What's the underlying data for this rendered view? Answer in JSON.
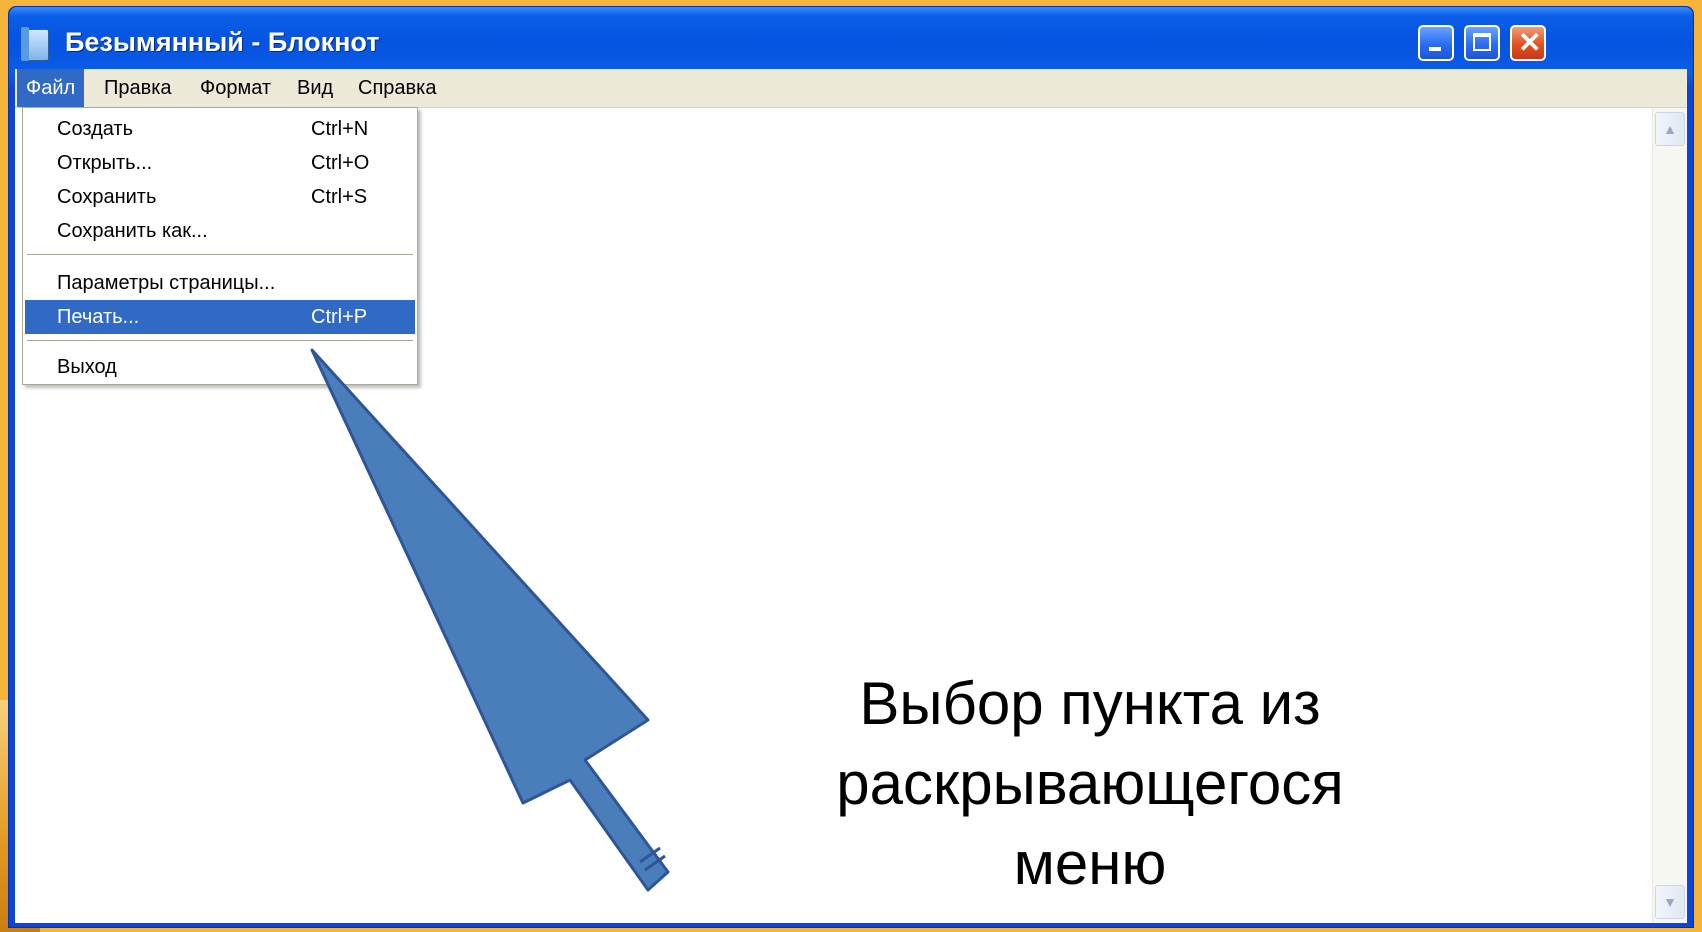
{
  "window": {
    "title": "Безымянный - Блокнот",
    "buttons": {
      "minimize": "minimize-icon",
      "maximize": "maximize-icon",
      "close": "close-icon"
    }
  },
  "menubar": {
    "items": [
      "Файл",
      "Правка",
      "Формат",
      "Вид",
      "Справка"
    ],
    "active": "Файл"
  },
  "file_menu": {
    "new": {
      "label": "Создать",
      "shortcut": "Ctrl+N"
    },
    "open": {
      "label": "Открыть...",
      "shortcut": "Ctrl+O"
    },
    "save": {
      "label": "Сохранить",
      "shortcut": "Ctrl+S"
    },
    "save_as": {
      "label": "Сохранить как..."
    },
    "page_setup": {
      "label": "Параметры страницы..."
    },
    "print": {
      "label": "Печать...",
      "shortcut": "Ctrl+P",
      "highlighted": true
    },
    "exit": {
      "label": "Выход"
    }
  },
  "annotation": {
    "line1": "Выбор пункта из",
    "line2": "раскрывающегося",
    "line3": "меню"
  },
  "colors": {
    "titlebar": "#0653e0",
    "menu_highlight": "#316ac5",
    "arrow_fill": "#4a7ebb",
    "slide_background": "#f4b53a"
  }
}
